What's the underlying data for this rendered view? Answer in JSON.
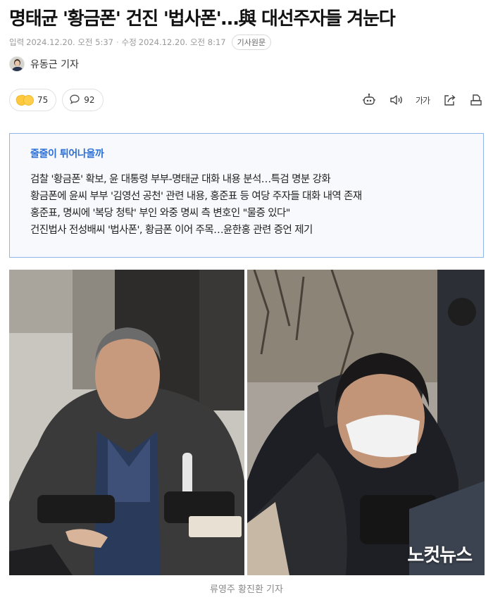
{
  "article": {
    "headline": "명태균 '황금폰' 건진 '법사폰'…與 대선주자들 겨눈다",
    "meta": {
      "input_label": "입력",
      "input_time": "2024.12.20. 오전 5:37",
      "modified_label": "수정",
      "modified_time": "2024.12.20. 오전 8:17",
      "original_button": "기사원문"
    },
    "reporter": "유동근 기자"
  },
  "reactions": {
    "emoji_count": "75",
    "comment_count": "92"
  },
  "toolbar": {
    "icons": [
      "ai-summary-icon",
      "speaker-icon",
      "font-size-icon",
      "share-icon",
      "print-icon"
    ],
    "font_size_label": "가가"
  },
  "summary": {
    "title": "줄줄이 튀어나올까",
    "lines": [
      "검찰 '황금폰' 확보, 윤 대통령 부부-명태균 대화 내용 분석…특검 명분 강화",
      "황금폰에 윤씨 부부 '김영선 공천' 관련 내용, 홍준표 등 여당 주자들 대화 내역 존재",
      "홍준표, 명씨에 '복당 청탁' 부인 와중 명씨 측 변호인 \"물증 있다\"",
      "건진법사 전성배씨 '법사폰', 황금폰 이어 주목…윤한홍 관련 증언 제기"
    ]
  },
  "photo": {
    "watermark": "노컷뉴스",
    "caption": "류영주 황진환 기자"
  },
  "colors": {
    "accent_blue": "#2c6fd6",
    "summary_border": "#8fb5ea",
    "meta_gray": "#9a9a9a"
  }
}
